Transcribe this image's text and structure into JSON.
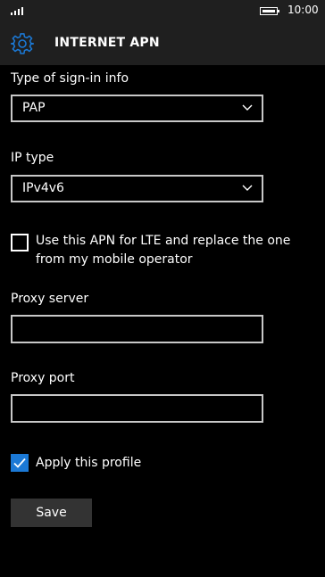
{
  "status_bar": {
    "time": "10:00"
  },
  "header": {
    "title": "INTERNET APN"
  },
  "sign_in": {
    "label": "Type of sign-in info",
    "value": "PAP"
  },
  "ip_type": {
    "label": "IP type",
    "value": "IPv4v6"
  },
  "lte_checkbox": {
    "text": "Use this APN for LTE and replace the one from my mobile operator",
    "checked": false
  },
  "proxy_server": {
    "label": "Proxy server",
    "value": ""
  },
  "proxy_port": {
    "label": "Proxy port",
    "value": ""
  },
  "apply_profile": {
    "text": "Apply this profile",
    "checked": true
  },
  "save": {
    "label": "Save"
  },
  "colors": {
    "accent": "#1b79d6",
    "background": "#000000",
    "bar": "#1f1f1f"
  }
}
